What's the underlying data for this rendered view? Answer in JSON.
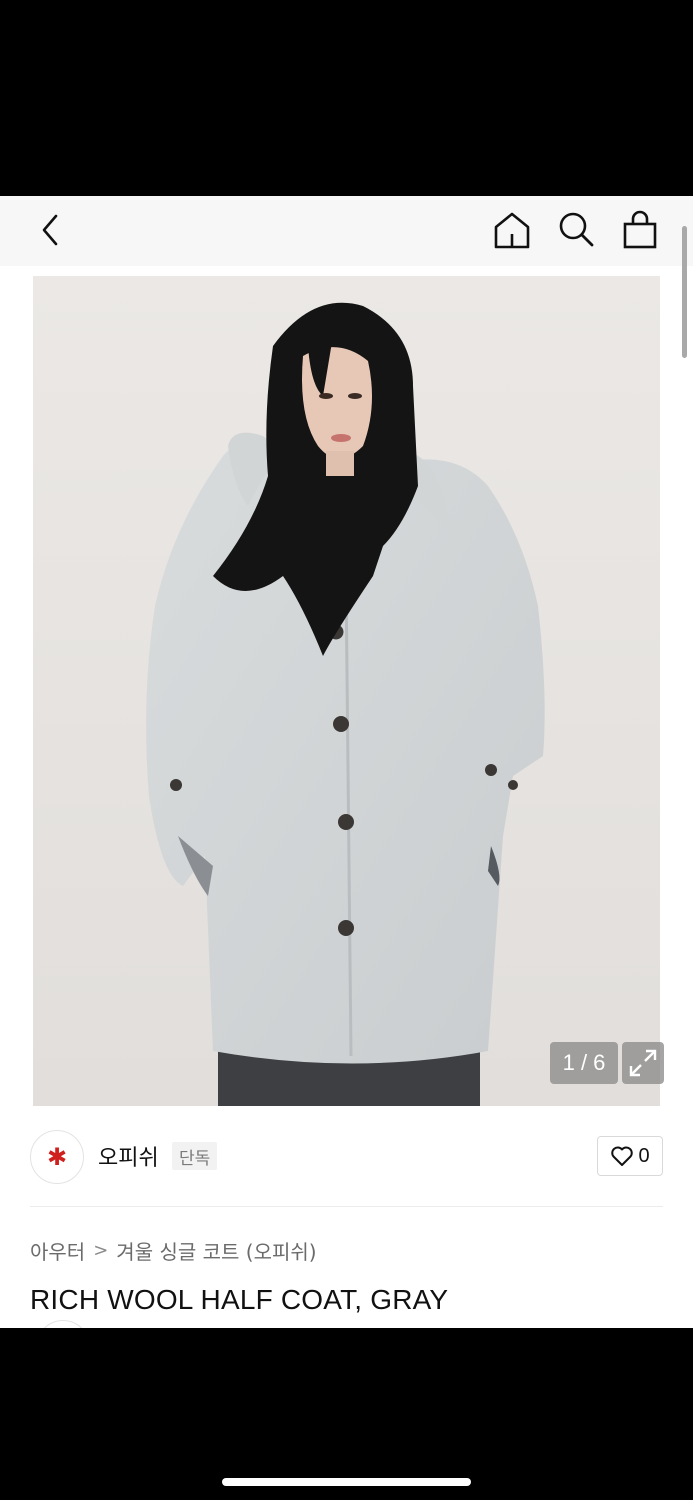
{
  "header": {
    "back_icon": "chevron-left-icon",
    "home_icon": "home-icon",
    "search_icon": "search-icon",
    "bag_icon": "shopping-bag-icon"
  },
  "gallery": {
    "current": 1,
    "total": 6,
    "pager_text": "1 / 6",
    "expand_icon": "expand-icon"
  },
  "brand": {
    "logo_icon": "flower-logo-icon",
    "name": "오피쉬",
    "badge": "단독",
    "accent_color": "#d0201e"
  },
  "like": {
    "icon": "heart-outline-icon",
    "count": "0"
  },
  "breadcrumb": {
    "category": "아우터",
    "separator": ">",
    "subcategory": "겨울 싱글 코트 (오피쉬)"
  },
  "product": {
    "title": "RICH WOOL HALF COAT, GRAY"
  }
}
